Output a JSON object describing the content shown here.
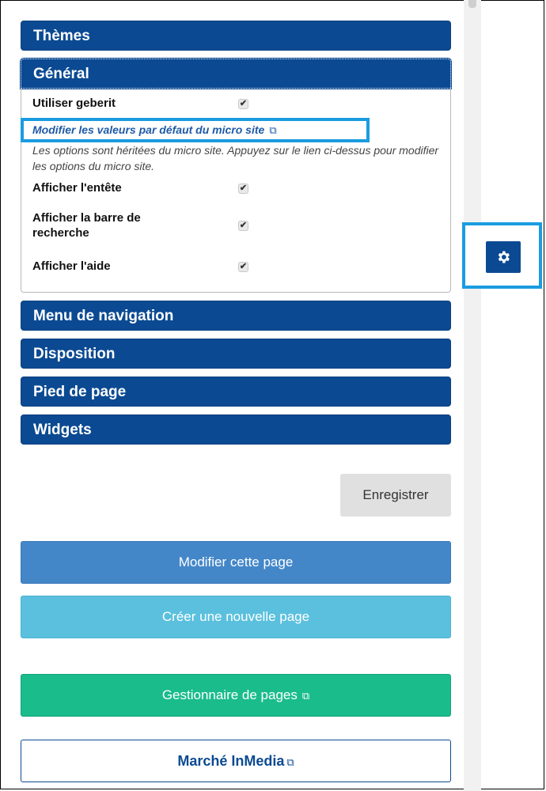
{
  "panel": {
    "sections": [
      {
        "label": "Thèmes"
      },
      {
        "label": "Général"
      },
      {
        "label": "Menu de navigation"
      },
      {
        "label": "Disposition"
      },
      {
        "label": "Pied de page"
      },
      {
        "label": "Widgets"
      }
    ],
    "general": {
      "use_label": "Utiliser geberit",
      "micro_link": "Modifier les valeurs par défaut du micro site",
      "note": "Les options sont héritées du micro site. Appuyez sur le lien ci-dessus pour modifier les options du micro site.",
      "options": [
        {
          "label": "Afficher l'entête",
          "checked": true
        },
        {
          "label": "Afficher la barre de recherche",
          "checked": true
        },
        {
          "label": "Afficher l'aide",
          "checked": true
        }
      ]
    }
  },
  "buttons": {
    "save": "Enregistrer",
    "modify": "Modifier cette page",
    "create": "Créer une nouvelle page",
    "manager": "Gestionnaire de pages",
    "market": "Marché InMedia"
  },
  "icons": {
    "external": "external-link-icon",
    "gear": "gear-icon"
  },
  "colors": {
    "header": "#0b4a92",
    "highlight": "#1a9ce0",
    "modify": "#4487c9",
    "create": "#5bc0de",
    "manager": "#1abc8c"
  }
}
